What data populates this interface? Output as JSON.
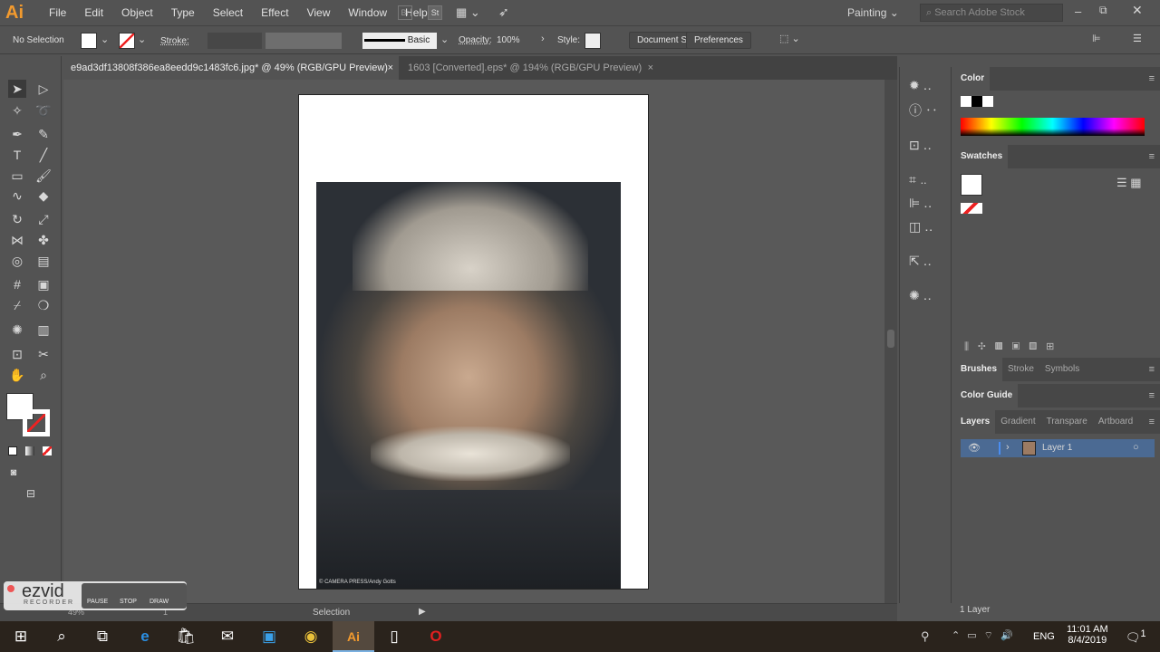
{
  "app": {
    "logo": "Ai",
    "menu": [
      "File",
      "Edit",
      "Object",
      "Type",
      "Select",
      "Effect",
      "View",
      "Window",
      "Help"
    ],
    "bridge": "Br",
    "stock": "St",
    "workspace": "Painting",
    "search_placeholder": "Search Adobe Stock"
  },
  "control": {
    "selection": "No Selection",
    "stroke_label": "Stroke:",
    "brush": "Basic",
    "opacity_label": "Opacity:",
    "opacity": "100%",
    "style_label": "Style:",
    "document_setup": "Document Setup",
    "preferences": "Preferences"
  },
  "tabs": [
    {
      "label": "e9ad3df13808f386ea8eedd9c1483fc6.jpg* @ 49% (RGB/GPU Preview)"
    },
    {
      "label": "1603 [Converted].eps* @ 194% (RGB/GPU Preview)"
    }
  ],
  "photo": {
    "credit": "© CAMERA PRESS/Andy Gotts"
  },
  "panels": {
    "color": "Color",
    "swatches": "Swatches",
    "brushes": "Brushes",
    "stroke": "Stroke",
    "symbols": "Symbols",
    "color_guide": "Color Guide",
    "layers": "Layers",
    "gradient": "Gradient",
    "transparency": "Transpare",
    "artboard": "Artboard",
    "layer_name": "Layer 1",
    "layer_count": "1 Layer"
  },
  "status": {
    "zoom": "49%",
    "artboard_num": "1",
    "tool": "Selection"
  },
  "ezvid": {
    "brand": "ezvid",
    "sub": "RECORDER",
    "pause": "PAUSE",
    "stop": "STOP",
    "draw": "DRAW"
  },
  "taskbar": {
    "lang": "ENG",
    "time": "11:01 AM",
    "date": "8/4/2019",
    "notifications": "1"
  }
}
